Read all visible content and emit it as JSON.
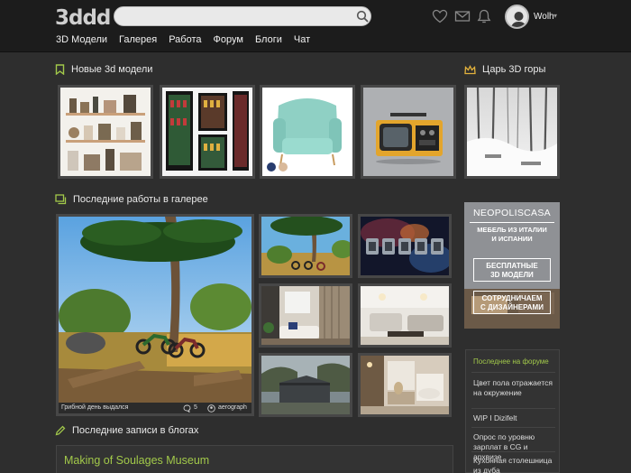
{
  "header": {
    "logo": "3ddd",
    "search_placeholder": "",
    "username": "Wolh",
    "nav": [
      "3D Модели",
      "Галерея",
      "Работа",
      "Форум",
      "Блоги",
      "Чат"
    ]
  },
  "sections": {
    "models_title": "Новые 3d модели",
    "king_title": "Царь 3D горы",
    "gallery_title": "Последние работы в галерее",
    "blogs_title": "Последние записи в блогах"
  },
  "gallery_main": {
    "caption": "Грибной день выдался",
    "comments": "5",
    "author": "aerograph"
  },
  "ad": {
    "brand": "NEOPOLISCASA",
    "line1": "МЕБЕЛЬ ИЗ ИТАЛИИ",
    "line2": "И ИСПАНИИ",
    "btn1_a": "БЕСПЛАТНЫЕ",
    "btn1_b": "3D МОДЕЛИ",
    "btn2_a": "СОТРУДНИЧАЕМ",
    "btn2_b": "С ДИЗАЙНЕРАМИ"
  },
  "forum": {
    "title": "Последнее на форуме",
    "items": [
      "Цвет пола отражается на окружение",
      "WIP I Dizifelt",
      "Опрос по уровню зарплат в CG и архвизе",
      "Кухонная столешница из дуба"
    ]
  },
  "blog": {
    "first_title": "Making of Soulages Museum"
  },
  "colors": {
    "accent": "#a2c94a",
    "header_bg": "#1c1c1c",
    "page_bg": "#2e2e2e"
  }
}
